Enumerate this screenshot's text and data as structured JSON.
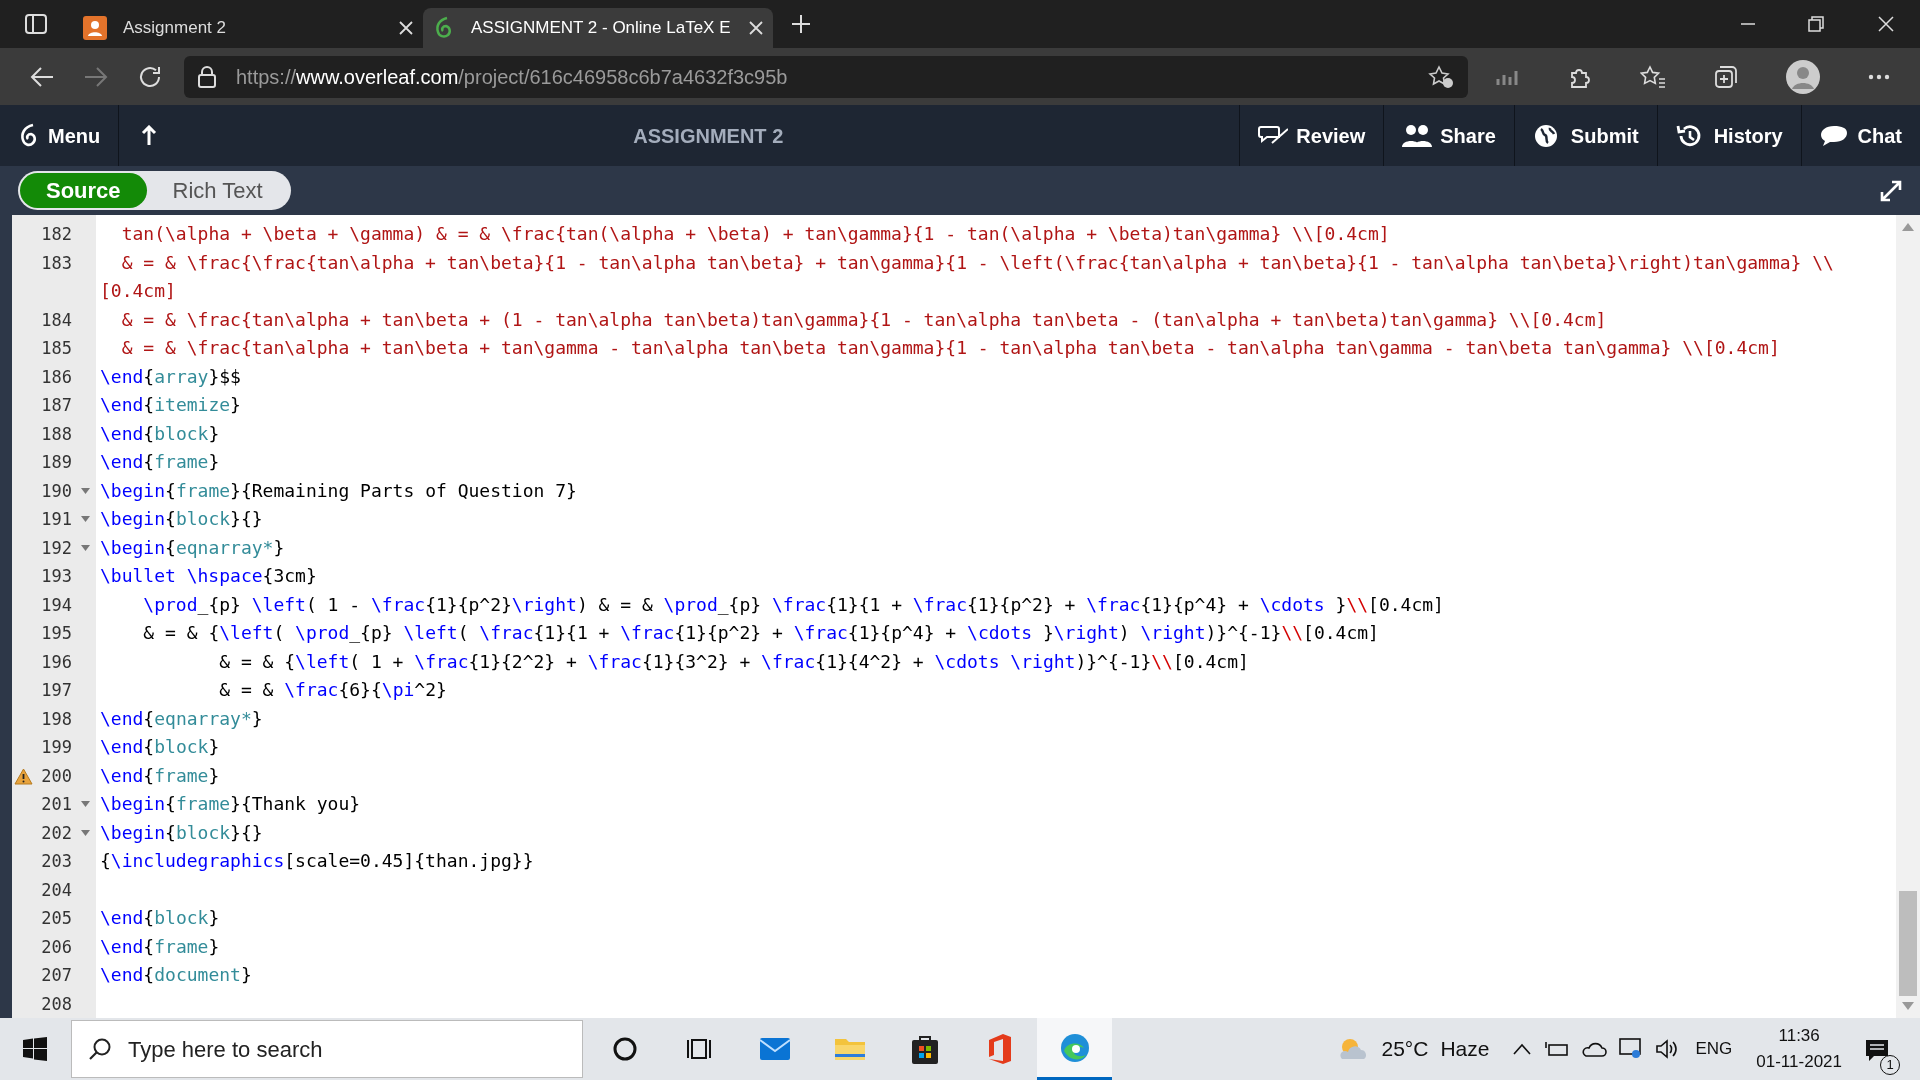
{
  "browser": {
    "tabs": [
      {
        "title": "Assignment 2",
        "selected": false
      },
      {
        "title": "ASSIGNMENT 2 - Online LaTeX E",
        "selected": true
      }
    ],
    "url": {
      "scheme": "https://",
      "domain": "www.overleaf.com",
      "path": "/project/616c46958c6b7a4632f3c95b"
    }
  },
  "toolbar": {
    "menu_label": "Menu",
    "title": "ASSIGNMENT 2",
    "actions": [
      {
        "kind": "review",
        "label": "Review"
      },
      {
        "kind": "share",
        "label": "Share"
      },
      {
        "kind": "submit",
        "label": "Submit"
      },
      {
        "kind": "history",
        "label": "History"
      },
      {
        "kind": "chat",
        "label": "Chat"
      }
    ]
  },
  "editor_modes": [
    {
      "label": "Source",
      "selected": true
    },
    {
      "label": "Rich Text",
      "selected": false
    }
  ],
  "editor": {
    "lines": [
      {
        "number": "182",
        "segments": [
          {
            "kind": "math",
            "text": "  tan(\\alpha + \\beta + \\gamma) & = & \\frac{tan(\\alpha + \\beta) + tan\\gamma}{1 - tan(\\alpha + \\beta)tan\\gamma} \\\\[0.4cm]"
          }
        ]
      },
      {
        "number": "183",
        "segments": [
          {
            "kind": "math",
            "text": "  & = & \\frac{\\frac{tan\\alpha + tan\\beta}{1 - tan\\alpha tan\\beta} + tan\\gamma}{1 - \\left(\\frac{tan\\alpha + tan\\beta}{1 - tan\\alpha tan\\beta}\\right)tan\\gamma} \\\\[0.4cm]"
          }
        ]
      },
      {
        "number": "184",
        "segments": [
          {
            "kind": "math",
            "text": "  & = & \\frac{tan\\alpha + tan\\beta + (1 - tan\\alpha tan\\beta)tan\\gamma}{1 - tan\\alpha tan\\beta - (tan\\alpha + tan\\beta)tan\\gamma} \\\\[0.4cm]"
          }
        ]
      },
      {
        "number": "185",
        "segments": [
          {
            "kind": "math",
            "text": "  & = & \\frac{tan\\alpha + tan\\beta + tan\\gamma - tan\\alpha tan\\beta tan\\gamma}{1 - tan\\alpha tan\\beta - tan\\alpha tan\\gamma - tan\\beta tan\\gamma} \\\\[0.4cm]"
          }
        ]
      },
      {
        "number": "186",
        "segments": [
          {
            "kind": "cmd",
            "text": "\\end"
          },
          {
            "kind": "plain",
            "text": "{"
          },
          {
            "kind": "env",
            "text": "array"
          },
          {
            "kind": "plain",
            "text": "}$$"
          }
        ]
      },
      {
        "number": "187",
        "segments": [
          {
            "kind": "cmd",
            "text": "\\end"
          },
          {
            "kind": "plain",
            "text": "{"
          },
          {
            "kind": "env",
            "text": "itemize"
          },
          {
            "kind": "plain",
            "text": "}"
          }
        ]
      },
      {
        "number": "188",
        "segments": [
          {
            "kind": "cmd",
            "text": "\\end"
          },
          {
            "kind": "plain",
            "text": "{"
          },
          {
            "kind": "env",
            "text": "block"
          },
          {
            "kind": "plain",
            "text": "}"
          }
        ]
      },
      {
        "number": "189",
        "segments": [
          {
            "kind": "cmd",
            "text": "\\end"
          },
          {
            "kind": "plain",
            "text": "{"
          },
          {
            "kind": "env",
            "text": "frame"
          },
          {
            "kind": "plain",
            "text": "}"
          }
        ]
      },
      {
        "number": "190",
        "fold": true,
        "segments": [
          {
            "kind": "cmd",
            "text": "\\begin"
          },
          {
            "kind": "plain",
            "text": "{"
          },
          {
            "kind": "env",
            "text": "frame"
          },
          {
            "kind": "plain",
            "text": "}{Remaining Parts of Question 7}"
          }
        ]
      },
      {
        "number": "191",
        "fold": true,
        "segments": [
          {
            "kind": "cmd",
            "text": "\\begin"
          },
          {
            "kind": "plain",
            "text": "{"
          },
          {
            "kind": "env",
            "text": "block"
          },
          {
            "kind": "plain",
            "text": "}{}"
          }
        ]
      },
      {
        "number": "192",
        "fold": true,
        "segments": [
          {
            "kind": "cmd",
            "text": "\\begin"
          },
          {
            "kind": "plain",
            "text": "{"
          },
          {
            "kind": "env",
            "text": "eqnarray*"
          },
          {
            "kind": "plain",
            "text": "}"
          }
        ]
      },
      {
        "number": "193",
        "segments": [
          {
            "kind": "cmd",
            "text": "\\bullet \\hspace"
          },
          {
            "kind": "plain",
            "text": "{3cm}"
          }
        ]
      },
      {
        "number": "194",
        "segments": [
          {
            "kind": "cmd",
            "text": "    \\prod"
          },
          {
            "kind": "plain",
            "text": "_{p} "
          },
          {
            "kind": "cmd",
            "text": "\\left"
          },
          {
            "kind": "plain",
            "text": "( 1 - "
          },
          {
            "kind": "cmd",
            "text": "\\frac"
          },
          {
            "kind": "plain",
            "text": "{1}{p^2}"
          },
          {
            "kind": "cmd",
            "text": "\\right"
          },
          {
            "kind": "plain",
            "text": ") & = & "
          },
          {
            "kind": "cmd",
            "text": "\\prod"
          },
          {
            "kind": "plain",
            "text": "_{p} "
          },
          {
            "kind": "cmd",
            "text": "\\frac"
          },
          {
            "kind": "plain",
            "text": "{1}{1 + "
          },
          {
            "kind": "cmd",
            "text": "\\frac"
          },
          {
            "kind": "plain",
            "text": "{1}{p^2} + "
          },
          {
            "kind": "cmd",
            "text": "\\frac"
          },
          {
            "kind": "plain",
            "text": "{1}{p^4} + "
          },
          {
            "kind": "cmd",
            "text": "\\cdots"
          },
          {
            "kind": "plain",
            "text": " }"
          },
          {
            "kind": "break",
            "text": "\\\\"
          },
          {
            "kind": "plain",
            "text": "[0.4cm]"
          }
        ]
      },
      {
        "number": "195",
        "segments": [
          {
            "kind": "plain",
            "text": "    & = & {"
          },
          {
            "kind": "cmd",
            "text": "\\left"
          },
          {
            "kind": "plain",
            "text": "( "
          },
          {
            "kind": "cmd",
            "text": "\\prod"
          },
          {
            "kind": "plain",
            "text": "_{p} "
          },
          {
            "kind": "cmd",
            "text": "\\left"
          },
          {
            "kind": "plain",
            "text": "( "
          },
          {
            "kind": "cmd",
            "text": "\\frac"
          },
          {
            "kind": "plain",
            "text": "{1}{1 + "
          },
          {
            "kind": "cmd",
            "text": "\\frac"
          },
          {
            "kind": "plain",
            "text": "{1}{p^2} + "
          },
          {
            "kind": "cmd",
            "text": "\\frac"
          },
          {
            "kind": "plain",
            "text": "{1}{p^4} + "
          },
          {
            "kind": "cmd",
            "text": "\\cdots"
          },
          {
            "kind": "plain",
            "text": " }"
          },
          {
            "kind": "cmd",
            "text": "\\right"
          },
          {
            "kind": "plain",
            "text": ") "
          },
          {
            "kind": "cmd",
            "text": "\\right"
          },
          {
            "kind": "plain",
            "text": ")}^{-1}"
          },
          {
            "kind": "break",
            "text": "\\\\"
          },
          {
            "kind": "plain",
            "text": "[0.4cm]"
          }
        ]
      },
      {
        "number": "196",
        "segments": [
          {
            "kind": "plain",
            "text": "           & = & {"
          },
          {
            "kind": "cmd",
            "text": "\\left"
          },
          {
            "kind": "plain",
            "text": "( 1 + "
          },
          {
            "kind": "cmd",
            "text": "\\frac"
          },
          {
            "kind": "plain",
            "text": "{1}{2^2} + "
          },
          {
            "kind": "cmd",
            "text": "\\frac"
          },
          {
            "kind": "plain",
            "text": "{1}{3^2} + "
          },
          {
            "kind": "cmd",
            "text": "\\frac"
          },
          {
            "kind": "plain",
            "text": "{1}{4^2} + "
          },
          {
            "kind": "cmd",
            "text": "\\cdots \\right"
          },
          {
            "kind": "plain",
            "text": ")}^{-1}"
          },
          {
            "kind": "break",
            "text": "\\\\"
          },
          {
            "kind": "plain",
            "text": "[0.4cm]"
          }
        ]
      },
      {
        "number": "197",
        "segments": [
          {
            "kind": "plain",
            "text": "           & = & "
          },
          {
            "kind": "cmd",
            "text": "\\frac"
          },
          {
            "kind": "plain",
            "text": "{6}{"
          },
          {
            "kind": "cmd",
            "text": "\\pi"
          },
          {
            "kind": "plain",
            "text": "^2}"
          }
        ]
      },
      {
        "number": "198",
        "segments": [
          {
            "kind": "cmd",
            "text": "\\end"
          },
          {
            "kind": "plain",
            "text": "{"
          },
          {
            "kind": "env",
            "text": "eqnarray*"
          },
          {
            "kind": "plain",
            "text": "}"
          }
        ]
      },
      {
        "number": "199",
        "segments": [
          {
            "kind": "cmd",
            "text": "\\end"
          },
          {
            "kind": "plain",
            "text": "{"
          },
          {
            "kind": "env",
            "text": "block"
          },
          {
            "kind": "plain",
            "text": "}"
          }
        ]
      },
      {
        "number": "200",
        "warning": true,
        "segments": [
          {
            "kind": "cmd",
            "text": "\\end"
          },
          {
            "kind": "plain",
            "text": "{"
          },
          {
            "kind": "env",
            "text": "frame"
          },
          {
            "kind": "plain",
            "text": "}"
          }
        ]
      },
      {
        "number": "201",
        "fold": true,
        "segments": [
          {
            "kind": "cmd",
            "text": "\\begin"
          },
          {
            "kind": "plain",
            "text": "{"
          },
          {
            "kind": "env",
            "text": "frame"
          },
          {
            "kind": "plain",
            "text": "}{Thank you}"
          }
        ]
      },
      {
        "number": "202",
        "fold": true,
        "segments": [
          {
            "kind": "cmd",
            "text": "\\begin"
          },
          {
            "kind": "plain",
            "text": "{"
          },
          {
            "kind": "env",
            "text": "block"
          },
          {
            "kind": "plain",
            "text": "}{}"
          }
        ]
      },
      {
        "number": "203",
        "segments": [
          {
            "kind": "plain",
            "text": "{"
          },
          {
            "kind": "cmd",
            "text": "\\includegraphics"
          },
          {
            "kind": "plain",
            "text": "[scale=0.45]{than.jpg}}"
          }
        ]
      },
      {
        "number": "204"
      },
      {
        "number": "205",
        "segments": [
          {
            "kind": "cmd",
            "text": "\\end"
          },
          {
            "kind": "plain",
            "text": "{"
          },
          {
            "kind": "env",
            "text": "block"
          },
          {
            "kind": "plain",
            "text": "}"
          }
        ]
      },
      {
        "number": "206",
        "segments": [
          {
            "kind": "cmd",
            "text": "\\end"
          },
          {
            "kind": "plain",
            "text": "{"
          },
          {
            "kind": "env",
            "text": "frame"
          },
          {
            "kind": "plain",
            "text": "}"
          }
        ]
      },
      {
        "number": "207",
        "segments": [
          {
            "kind": "cmd",
            "text": "\\end"
          },
          {
            "kind": "plain",
            "text": "{"
          },
          {
            "kind": "env",
            "text": "document"
          },
          {
            "kind": "plain",
            "text": "}"
          }
        ]
      },
      {
        "number": "208"
      }
    ]
  },
  "taskbar": {
    "search_placeholder": "Type here to search",
    "weather": {
      "temperature": "25°C",
      "condition": "Haze"
    },
    "language": "ENG",
    "time": "11:36",
    "date": "01-11-2021",
    "notification_count": "1"
  }
}
